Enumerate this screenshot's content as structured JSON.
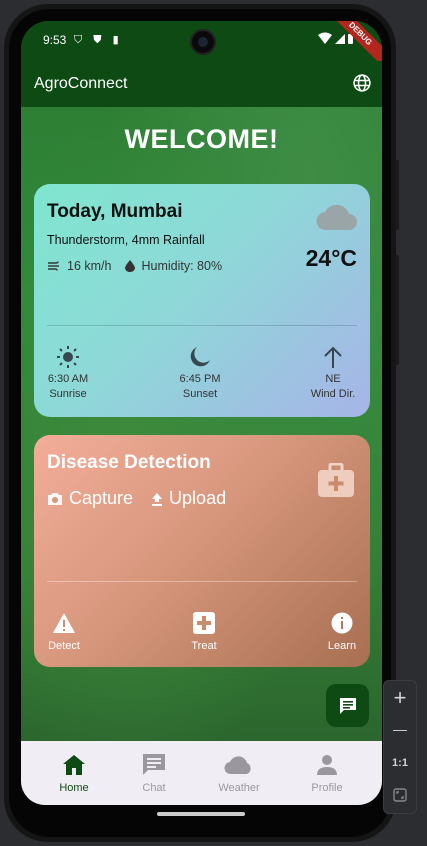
{
  "status_bar": {
    "time": "9:53",
    "debug_label": "DEBUG"
  },
  "app_bar": {
    "title": "AgroConnect",
    "language_icon": "globe-icon"
  },
  "welcome": "WELCOME!",
  "weather": {
    "title": "Today, Mumbai",
    "condition": "Thunderstorm, 4mm Rainfall",
    "wind": "16 km/h",
    "humidity": "Humidity: 80%",
    "temperature": "24°C",
    "sunrise_time": "6:30 AM",
    "sunrise_label": "Sunrise",
    "sunset_time": "6:45 PM",
    "sunset_label": "Sunset",
    "wind_dir_value": "NE",
    "wind_dir_label": "Wind Dir."
  },
  "disease": {
    "title": "Disease Detection",
    "capture": "Capture",
    "upload": "Upload",
    "detect": "Detect",
    "treat": "Treat",
    "learn": "Learn"
  },
  "bottom_nav": {
    "home": "Home",
    "chat": "Chat",
    "weather": "Weather",
    "profile": "Profile"
  },
  "emulator_tools": {
    "plus": "+",
    "minus": "—",
    "ratio": "1:1"
  },
  "colors": {
    "primary": "#0e4a14",
    "weather_card_start": "#7fe6cf",
    "weather_card_end": "#a7b4e8",
    "disease_card_start": "#f3ad99",
    "disease_card_end": "#a86f52"
  }
}
